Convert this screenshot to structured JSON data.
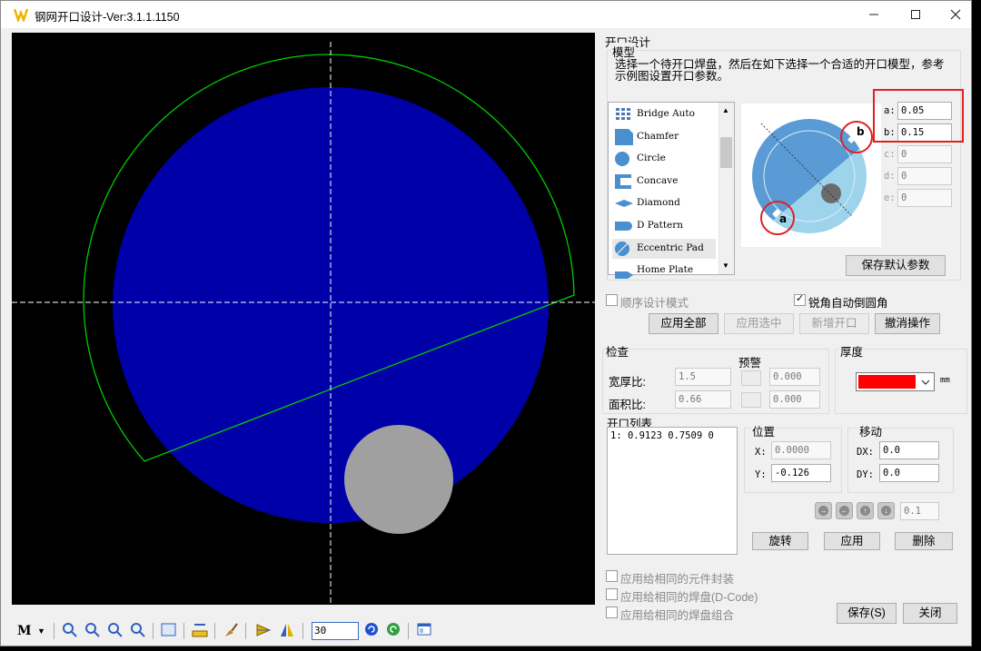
{
  "window": {
    "title": "钢网开口设计-Ver:3.1.1.1150",
    "min_icon": "minimize-icon",
    "max_icon": "maximize-icon",
    "close_icon": "close-icon"
  },
  "toolbar": {
    "m_label": "M",
    "zoom_value": "30"
  },
  "design": {
    "group_label": "开口设计",
    "model_label": "模型",
    "instructions": "选择一个待开口焊盘，然后在如下选择一个合适的开口模型，参考示例图设置开口参数。",
    "models": [
      {
        "name": "Bridge Auto",
        "icon": "bridge-auto-icon"
      },
      {
        "name": "Chamfer",
        "icon": "chamfer-icon"
      },
      {
        "name": "Circle",
        "icon": "circle-icon"
      },
      {
        "name": "Concave",
        "icon": "concave-icon"
      },
      {
        "name": "Diamond",
        "icon": "diamond-icon"
      },
      {
        "name": "D Pattern",
        "icon": "d-pattern-icon"
      },
      {
        "name": "Eccentric Pad",
        "icon": "eccentric-pad-icon"
      },
      {
        "name": "Home Plate",
        "icon": "home-plate-icon"
      }
    ],
    "selected_model": "Eccentric Pad",
    "preview_labels": {
      "a": "a",
      "b": "b"
    },
    "params": [
      {
        "key": "a:",
        "value": "0.05",
        "enabled": true
      },
      {
        "key": "b:",
        "value": "0.15",
        "enabled": true
      },
      {
        "key": "c:",
        "value": "0",
        "enabled": false
      },
      {
        "key": "d:",
        "value": "0",
        "enabled": false
      },
      {
        "key": "e:",
        "value": "0",
        "enabled": false
      }
    ],
    "save_default": "保存默认参数",
    "sequential_mode": "顺序设计模式",
    "auto_round": "锐角自动倒圆角",
    "apply_all": "应用全部",
    "apply_selected": "应用选中",
    "add_opening": "新增开口",
    "undo": "撤消操作"
  },
  "check": {
    "label": "检查",
    "warning_label": "预警",
    "width_thickness_label": "宽厚比:",
    "width_thickness_value": "1.5",
    "width_thickness_warn": "0.000",
    "area_ratio_label": "面积比:",
    "area_ratio_value": "0.66",
    "area_ratio_warn": "0.000"
  },
  "thickness": {
    "label": "厚度",
    "unit": "mm",
    "swatch_color": "#ff0000"
  },
  "openings": {
    "label": "开口列表",
    "items": [
      "1: 0.9123 0.7509 0"
    ]
  },
  "position": {
    "label": "位置",
    "x_label": "X:",
    "x_value": "0.0000",
    "y_label": "Y:",
    "y_value": "-0.126"
  },
  "move": {
    "label": "移动",
    "dx_label": "DX:",
    "dx_value": "0.0",
    "dy_label": "DY:",
    "dy_value": "0.0",
    "step_value": "0.1",
    "rotate": "旋转",
    "apply": "应用",
    "delete": "删除"
  },
  "footer": {
    "apply_same_package": "应用给相同的元件封装",
    "apply_same_pad": "应用给相同的焊盘(D-Code)",
    "apply_same_combo": "应用给相同的焊盘组合",
    "save": "保存(S)",
    "close": "关闭"
  },
  "colors": {
    "pad_fill": "#0000a8",
    "outline": "#00cc00",
    "circle_fill": "#a0a0a0",
    "preview_dark": "#5b9bd5",
    "preview_light": "#9dd4ec",
    "highlight": "#e02020"
  }
}
